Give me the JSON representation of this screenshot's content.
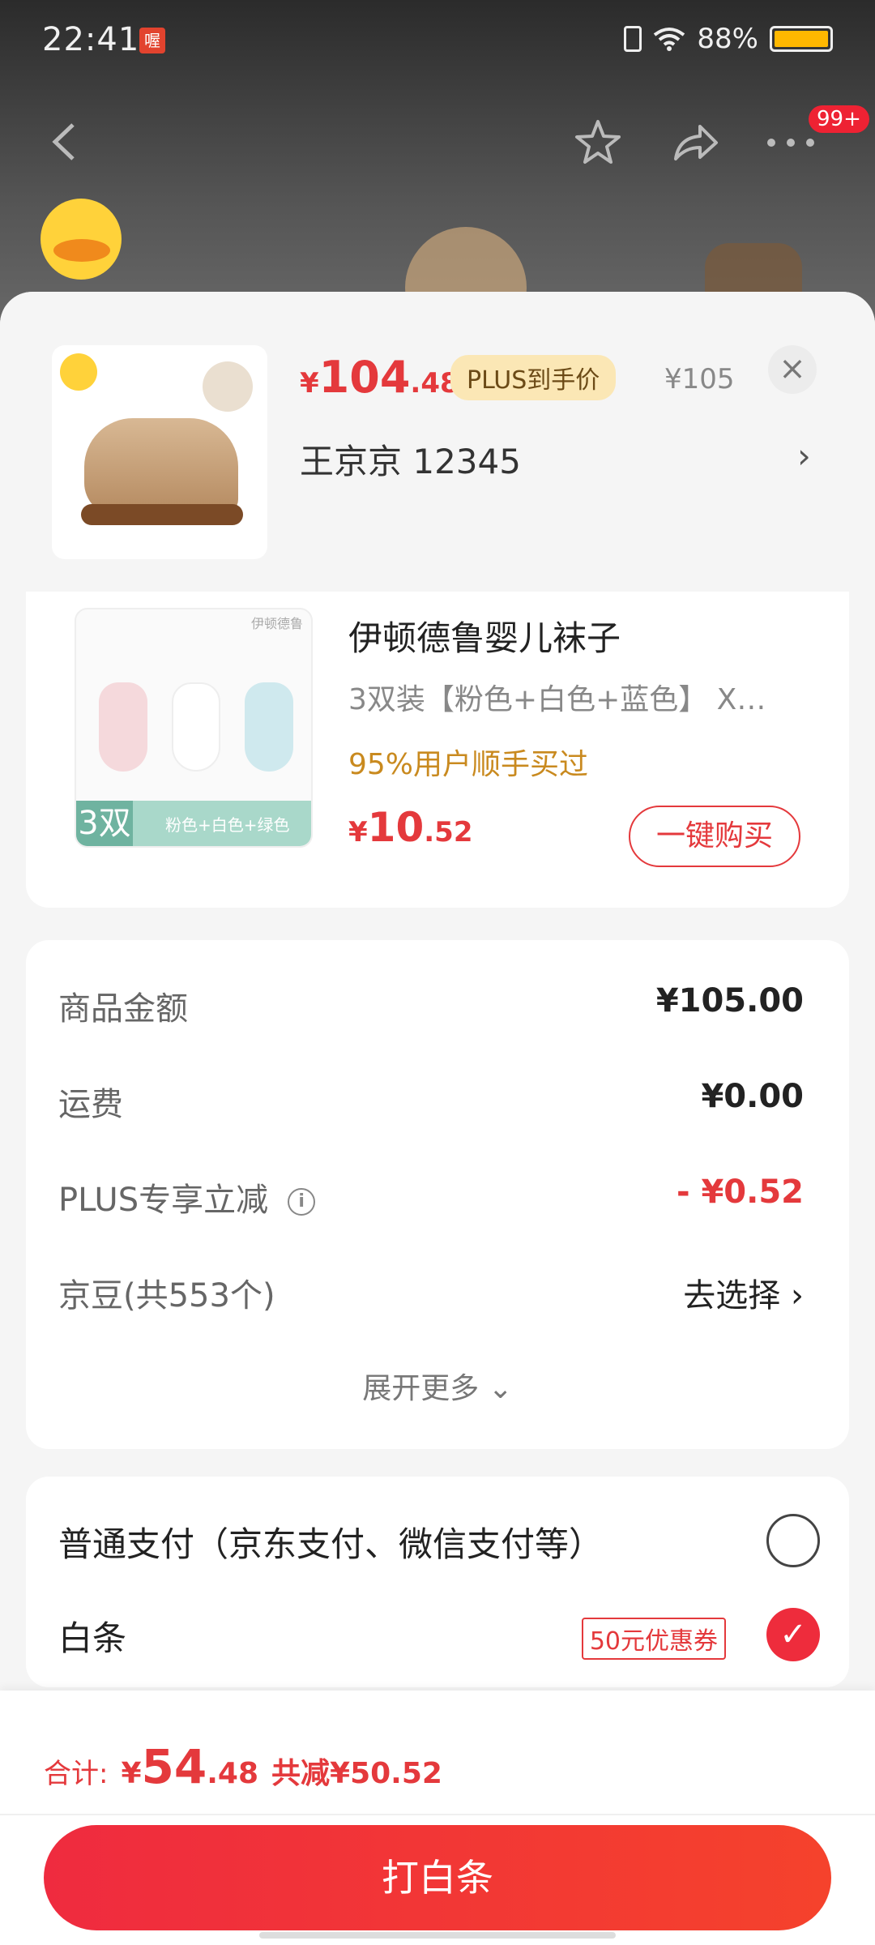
{
  "status_bar": {
    "time": "22:41",
    "app_badge": "喔",
    "battery": "88%"
  },
  "nav": {
    "more_badge": "99+"
  },
  "product": {
    "price_symbol": "¥",
    "price_int": "104",
    "price_dec": ".48",
    "plus_label": "PLUS到手价",
    "original_price": "¥105",
    "address": "王京京  12345",
    "close": "×",
    "arrow": "›"
  },
  "recommendation": {
    "image_brand": "伊顿德鲁",
    "image_band_num": "3双",
    "image_band_text": "粉色+白色+绿色",
    "title": "伊顿德鲁婴儿袜子",
    "spec": "3双装【粉色+白色+蓝色】  X…",
    "social_proof": "95%用户顺手买过",
    "price_symbol": "¥",
    "price_int": "10",
    "price_dec": ".52",
    "buy_label": "一键购买"
  },
  "summary": {
    "rows": [
      {
        "label": "商品金额",
        "value": "¥105.00"
      },
      {
        "label": "运费",
        "value": "¥0.00"
      },
      {
        "label": "PLUS专享立减",
        "value": "- ¥0.52"
      },
      {
        "label": "京豆(共553个)",
        "value": "去选择 ›"
      }
    ],
    "expand_label": "展开更多 ⌄"
  },
  "payment": {
    "options": [
      {
        "label": "普通支付（京东支付、微信支付等）",
        "selected": false
      },
      {
        "label": "白条",
        "coupon": "50元优惠券",
        "selected": true
      }
    ]
  },
  "footer": {
    "total_label": "合计:",
    "total_symbol": "¥",
    "total_int": "54",
    "total_dec": ".48",
    "reduce_text": "共减¥50.52",
    "pay_button": "打白条"
  },
  "colors": {
    "accent": "#e4393c",
    "plus_bg": "#fbe7b5",
    "social": "#c98a1f"
  }
}
